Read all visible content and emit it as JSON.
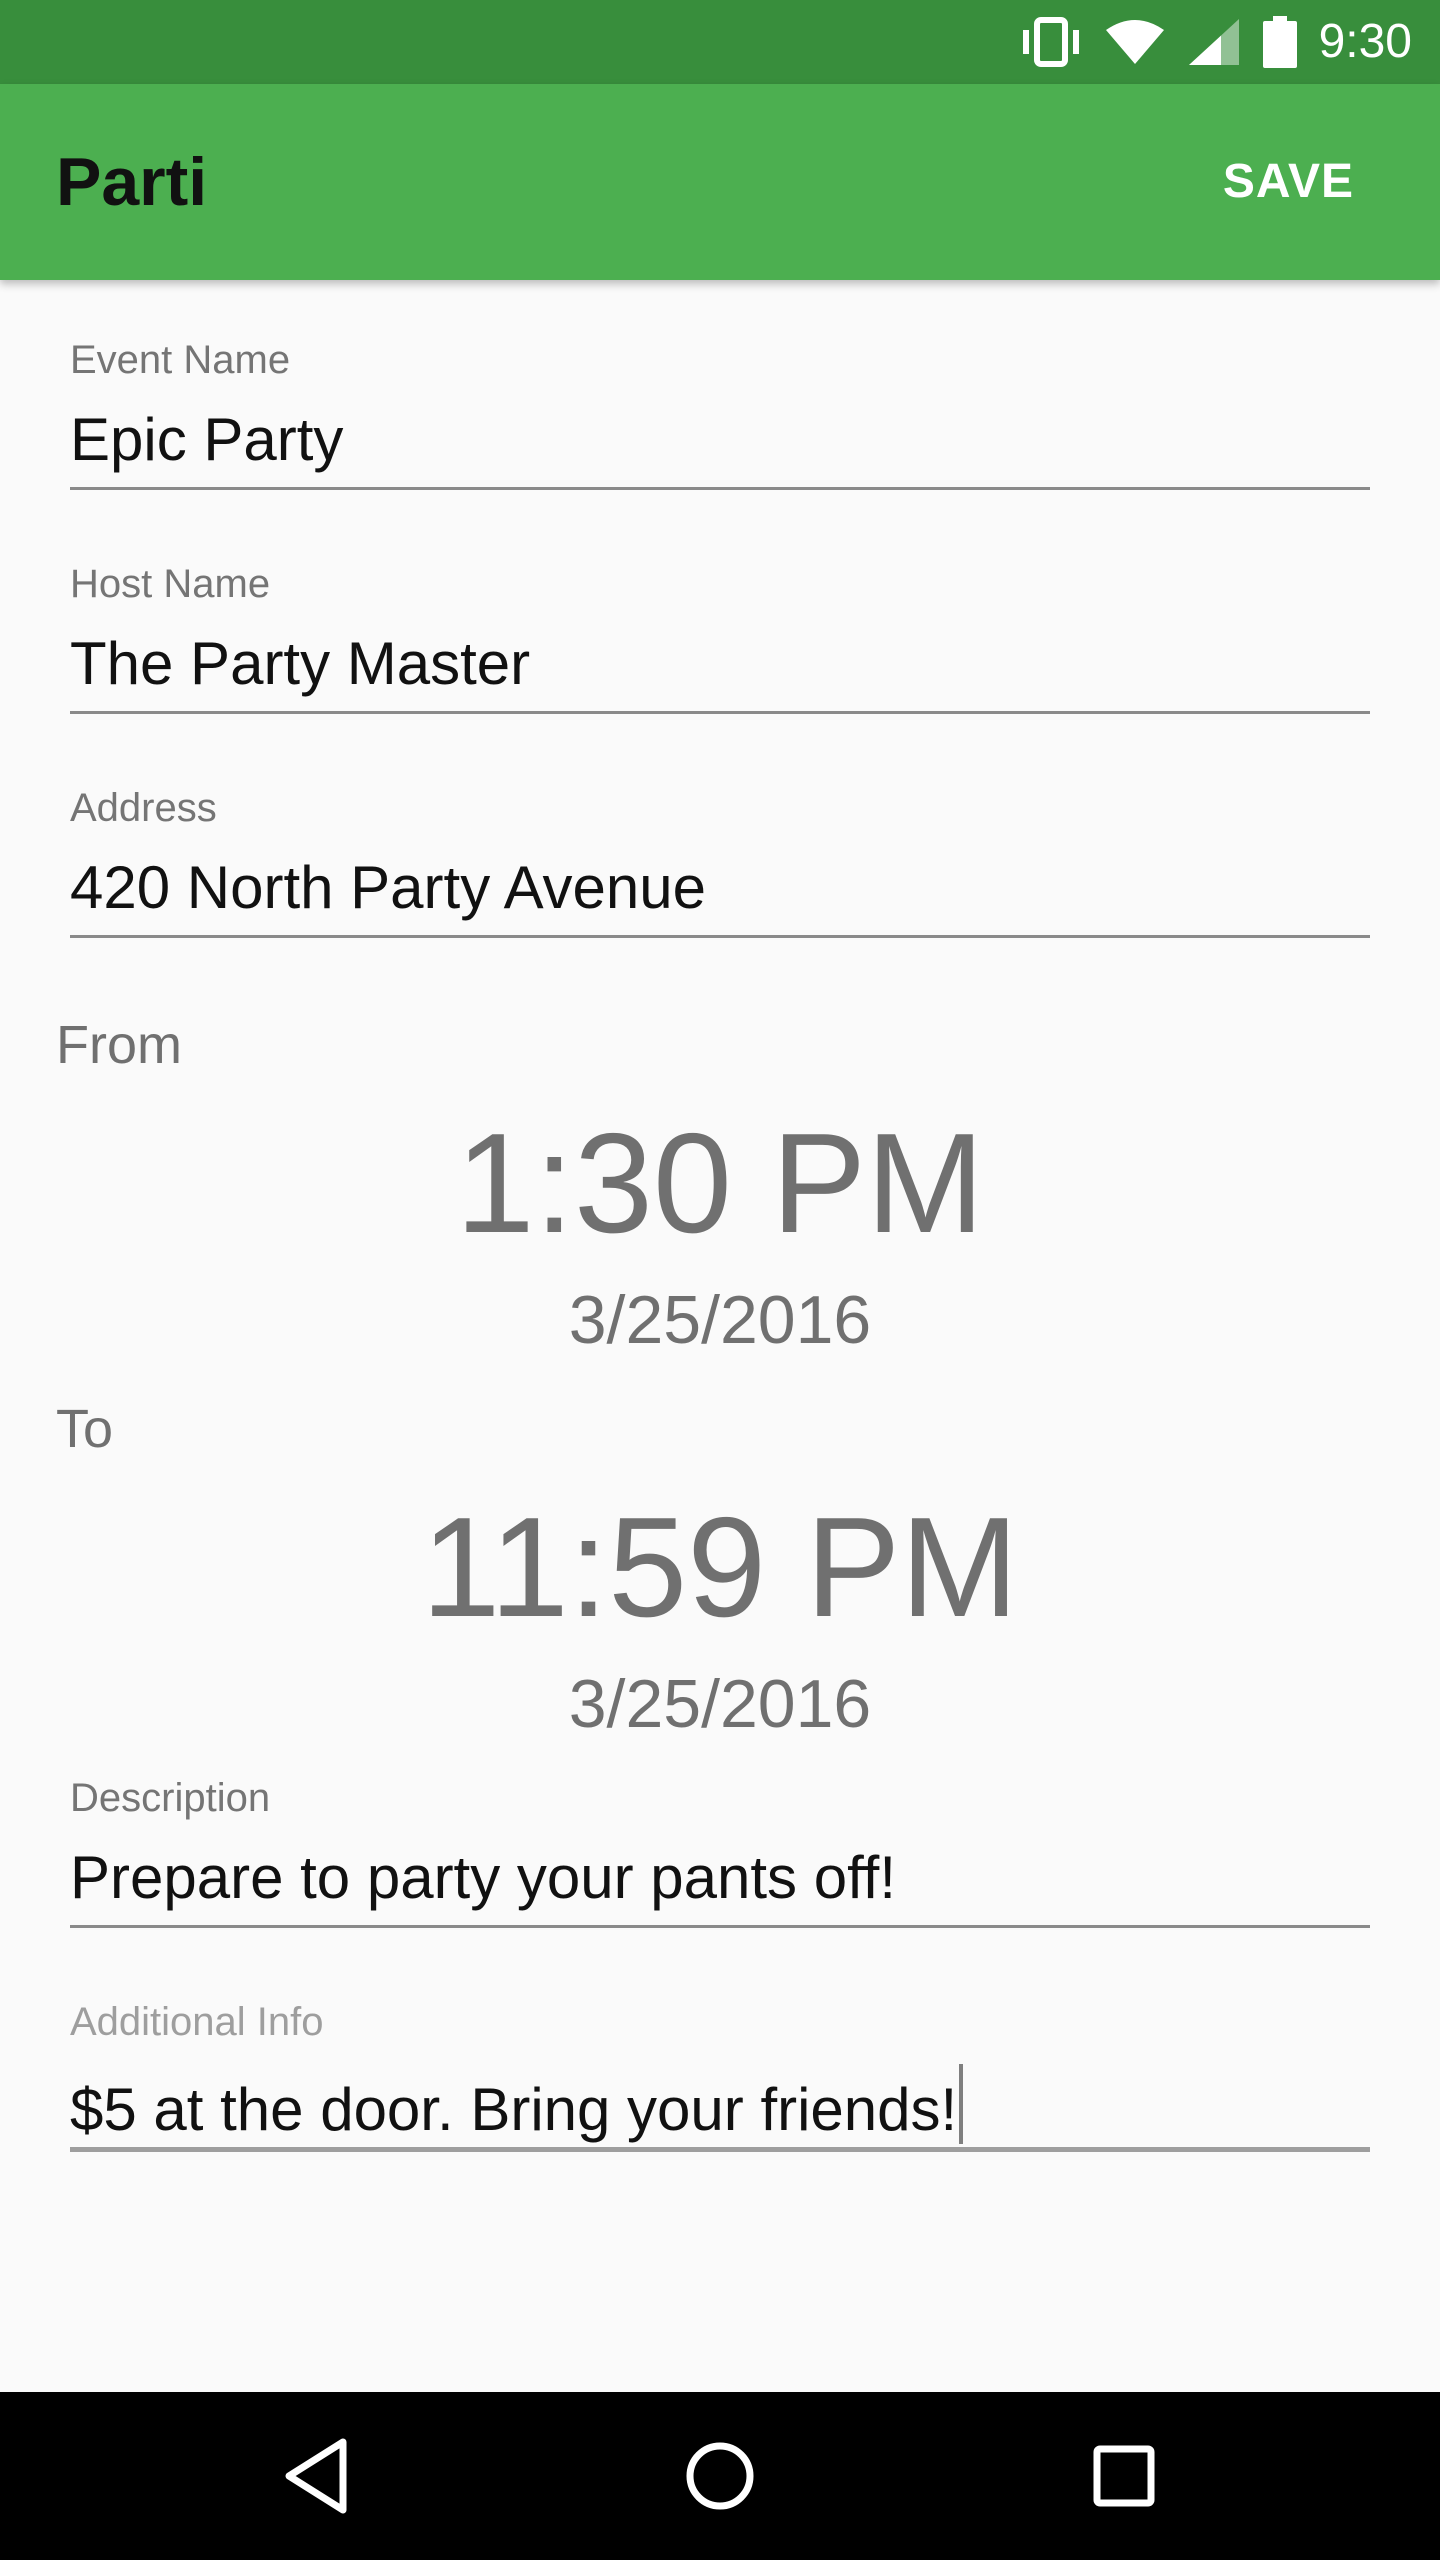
{
  "status_bar": {
    "time": "9:30",
    "icons": [
      "vibrate-icon",
      "wifi-icon",
      "signal-icon",
      "battery-icon"
    ]
  },
  "app_bar": {
    "title": "Parti",
    "save_label": "SAVE",
    "color": "#4caf50",
    "status_color": "#388e3c"
  },
  "form": {
    "event_name": {
      "label": "Event Name",
      "value": "Epic Party"
    },
    "host_name": {
      "label": "Host Name",
      "value": "The Party Master"
    },
    "address": {
      "label": "Address",
      "value": "420 North Party Avenue"
    },
    "from": {
      "label": "From",
      "time": "1:30 PM",
      "date": "3/25/2016"
    },
    "to": {
      "label": "To",
      "time": "11:59 PM",
      "date": "3/25/2016"
    },
    "description": {
      "label": "Description",
      "value": "Prepare to party your pants off!"
    },
    "additional_info": {
      "label": "Additional Info",
      "value": "$5 at the door. Bring your friends!"
    }
  },
  "nav_bar": {
    "icons": [
      "back-icon",
      "home-icon",
      "recents-icon"
    ]
  }
}
